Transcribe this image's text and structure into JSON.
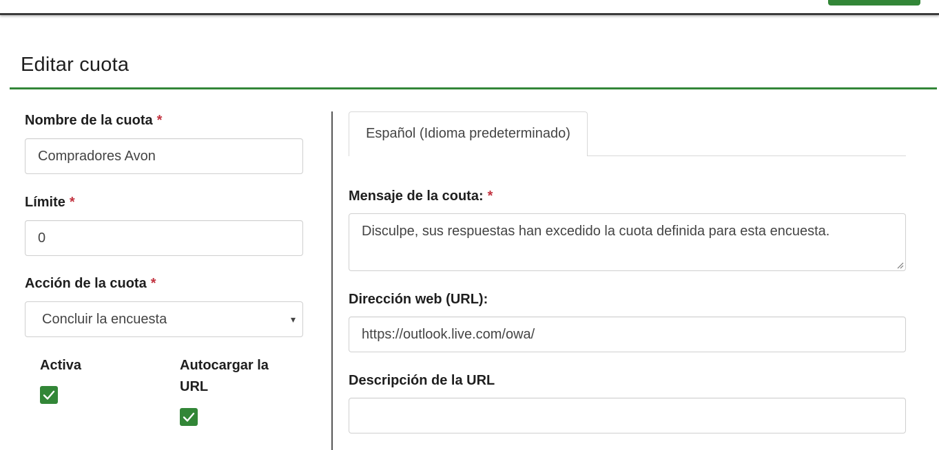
{
  "page": {
    "title": "Editar cuota"
  },
  "form": {
    "quota_name": {
      "label": "Nombre de la cuota",
      "required_mark": "*",
      "value": "Compradores Avon"
    },
    "limit": {
      "label": "Límite",
      "required_mark": "*",
      "value": "0"
    },
    "action": {
      "label": "Acción de la cuota",
      "required_mark": "*",
      "selected": "Concluir la encuesta",
      "arrow": "▾"
    },
    "active": {
      "label": "Activa",
      "checked": true
    },
    "autoload_url": {
      "label_line1": "Autocargar la",
      "label_line2": "URL",
      "checked": true
    }
  },
  "language_tabs": [
    {
      "label": "Español (Idioma predeterminado)",
      "active": true
    }
  ],
  "localized": {
    "message": {
      "label": "Mensaje de la couta:",
      "required_mark": "*",
      "value": "Disculpe, sus respuestas han excedido la cuota definida para esta encuesta."
    },
    "url": {
      "label": "Dirección web (URL):",
      "value": "https://outlook.live.com/owa/"
    },
    "url_description": {
      "label": "Descripción de la URL",
      "value": ""
    }
  },
  "colors": {
    "accent": "#328637",
    "required": "#c2323f"
  },
  "icons": {
    "checkbox": "check-icon",
    "select": "chevron-down-icon",
    "resize": "resize-handle-icon"
  }
}
